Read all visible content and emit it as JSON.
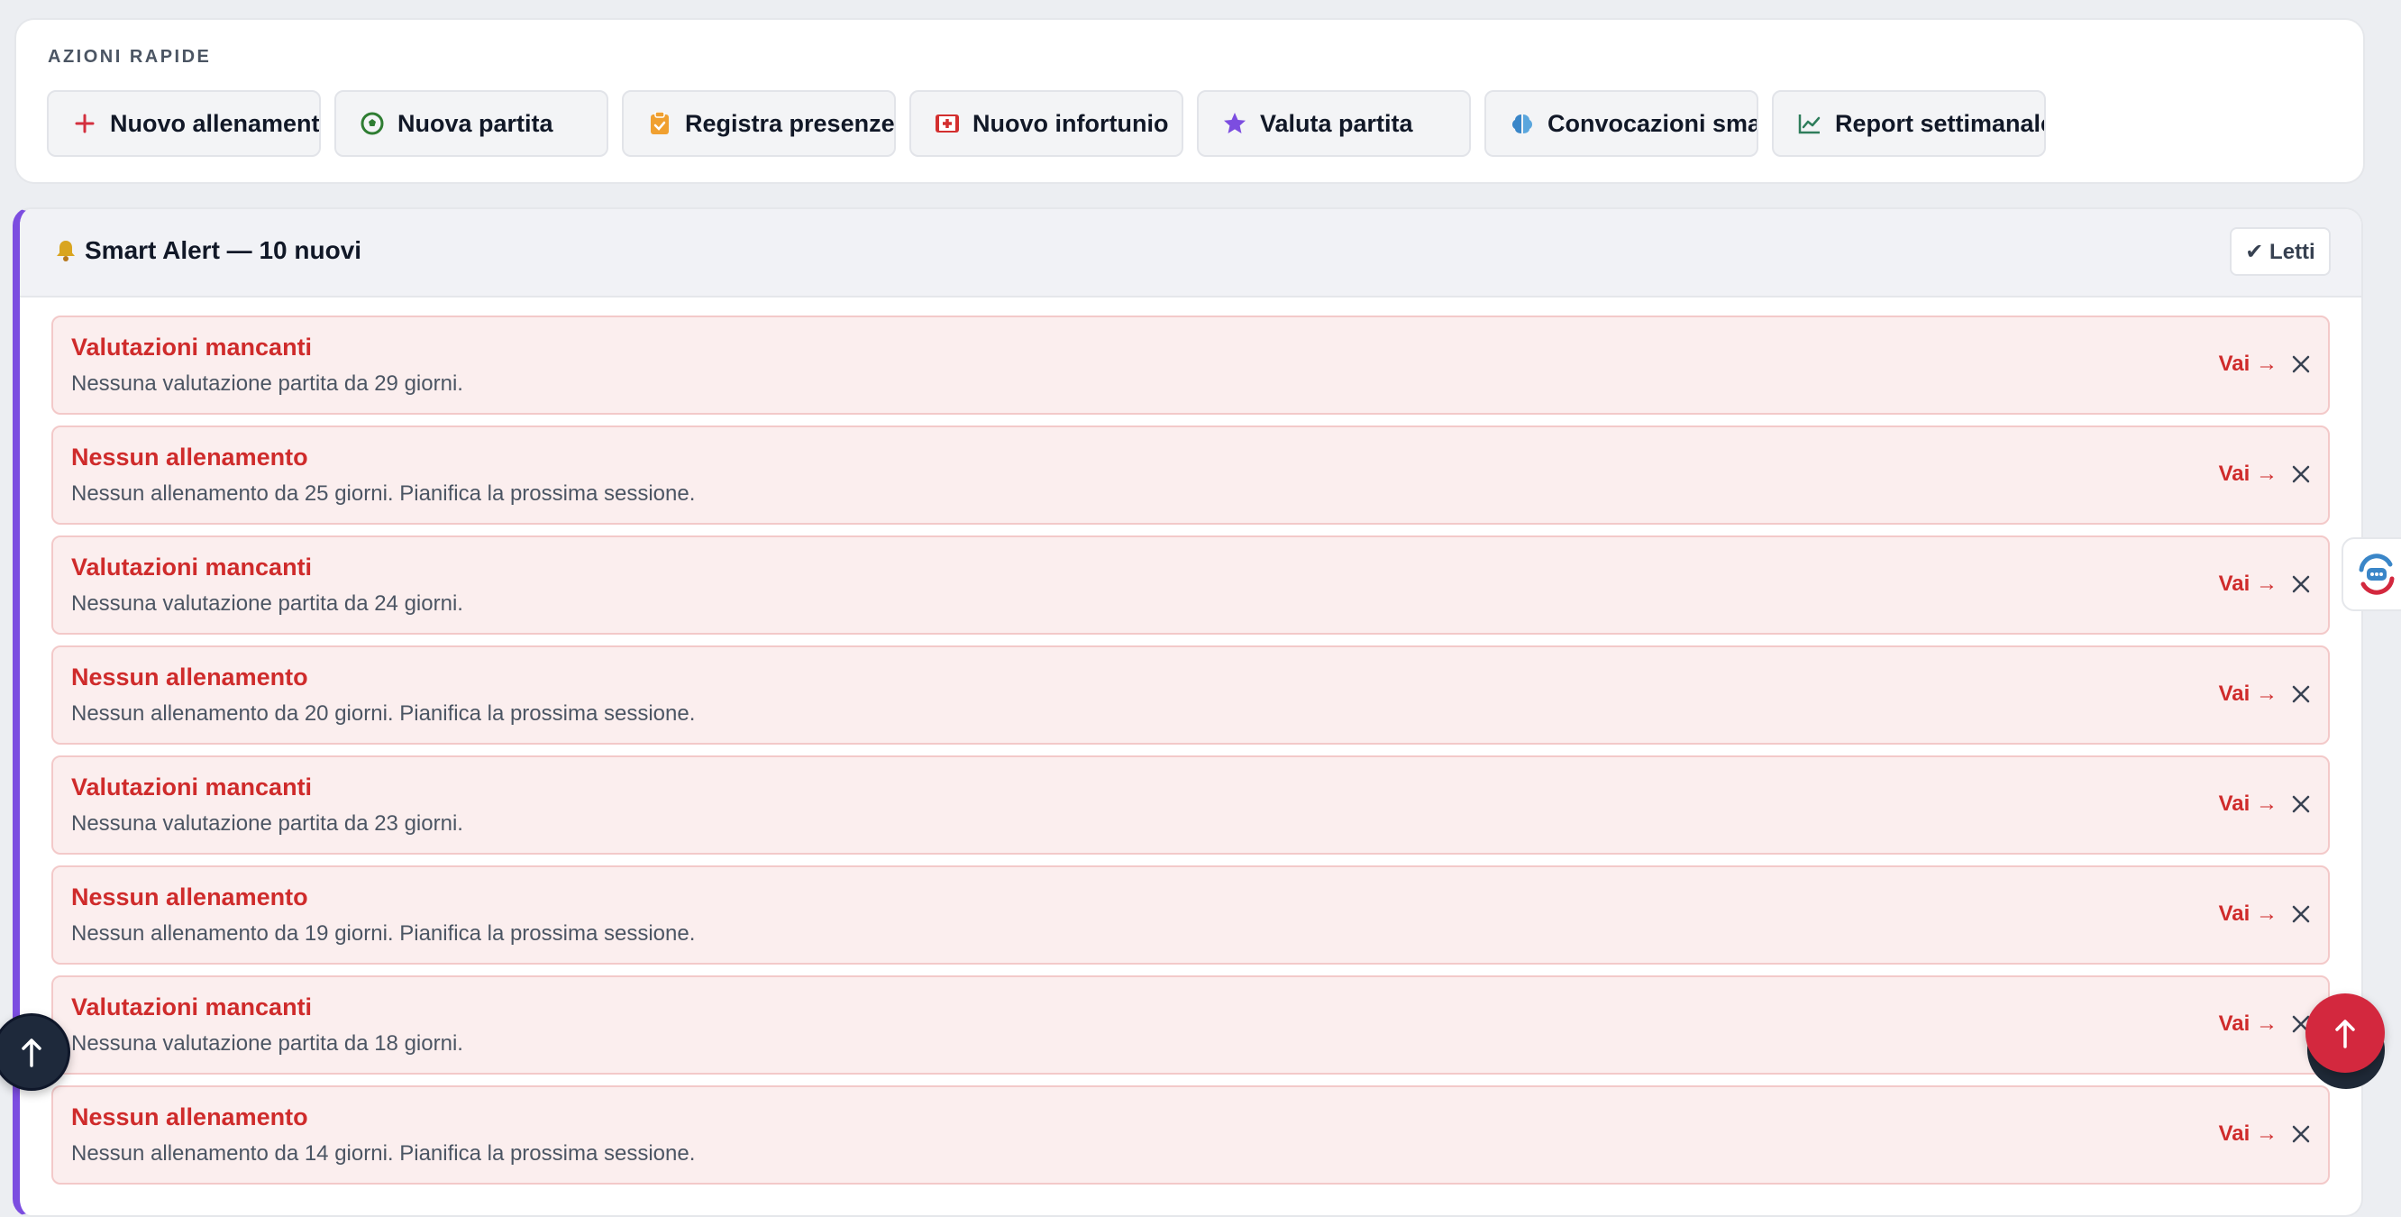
{
  "quick_actions": {
    "title": "AZIONI RAPIDE",
    "buttons": [
      {
        "label": "Nuovo allenamento",
        "icon": "plus-icon",
        "color": "#d32f3e"
      },
      {
        "label": "Nuova partita",
        "icon": "soccer-ball-icon",
        "color": "#2e7d32"
      },
      {
        "label": "Registra presenze",
        "icon": "clipboard-check-icon",
        "color": "#f0a030"
      },
      {
        "label": "Nuovo infortunio",
        "icon": "first-aid-kit-icon",
        "color": "#d32f2f"
      },
      {
        "label": "Valuta partita",
        "icon": "star-icon",
        "color": "#7c4de0"
      },
      {
        "label": "Convocazioni smart",
        "icon": "brain-icon",
        "color": "#3a86c8"
      },
      {
        "label": "Report settimanale",
        "icon": "line-chart-icon",
        "color": "#2e7d5b"
      }
    ]
  },
  "smart_alert": {
    "title": "Smart Alert — 10 nuovi",
    "read_button": "✔ Letti",
    "items": [
      {
        "title": "Valutazioni mancanti",
        "description": "Nessuna valutazione partita da 29 giorni.",
        "action": "Vai →"
      },
      {
        "title": "Nessun allenamento",
        "description": "Nessun allenamento da 25 giorni. Pianifica la prossima sessione.",
        "action": "Vai →"
      },
      {
        "title": "Valutazioni mancanti",
        "description": "Nessuna valutazione partita da 24 giorni.",
        "action": "Vai →"
      },
      {
        "title": "Nessun allenamento",
        "description": "Nessun allenamento da 20 giorni. Pianifica la prossima sessione.",
        "action": "Vai →"
      },
      {
        "title": "Valutazioni mancanti",
        "description": "Nessuna valutazione partita da 23 giorni.",
        "action": "Vai →"
      },
      {
        "title": "Nessun allenamento",
        "description": "Nessun allenamento da 19 giorni. Pianifica la prossima sessione.",
        "action": "Vai →"
      },
      {
        "title": "Valutazioni mancanti",
        "description": "Nessuna valutazione partita da 18 giorni.",
        "action": "Vai →"
      },
      {
        "title": "Nessun allenamento",
        "description": "Nessun allenamento da 14 giorni. Pianifica la prossima sessione.",
        "action": "Vai →"
      }
    ]
  },
  "colors": {
    "accent_purple": "#7c4de0",
    "alert_red": "#cf2b2b",
    "fab_red": "#d3283e",
    "fab_dark": "#1e293b"
  },
  "floating": {
    "scroll_top_left_icon": "arrow-up-icon",
    "scroll_top_right_icon": "arrow-up-icon",
    "side_widget_icon": "chat-sync-icon"
  }
}
